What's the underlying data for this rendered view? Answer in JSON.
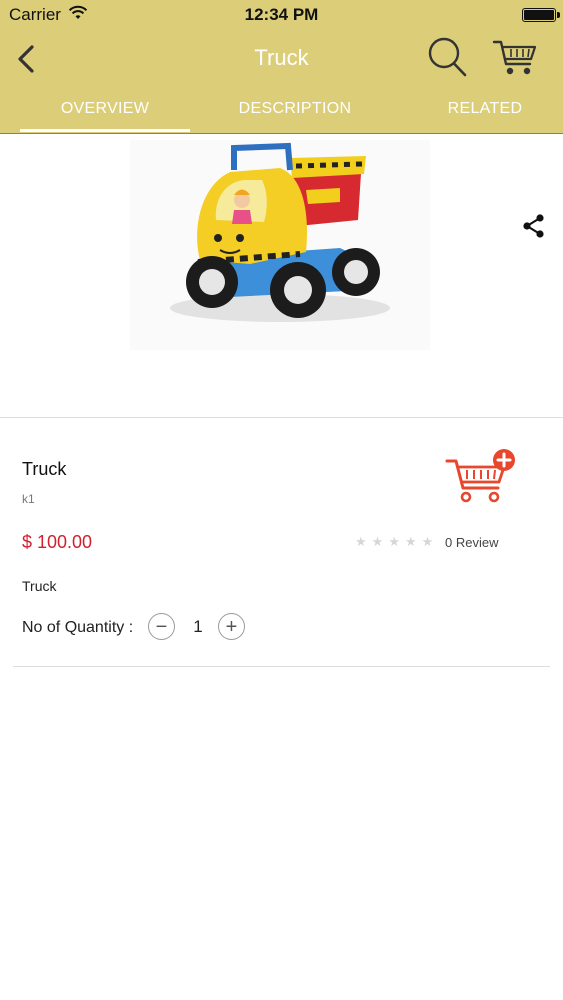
{
  "status_bar": {
    "carrier": "Carrier",
    "time": "12:34 PM",
    "battery_level": 1.0
  },
  "nav": {
    "title": "Truck"
  },
  "tabs": [
    {
      "label": "OVERVIEW",
      "active": true
    },
    {
      "label": "DESCRIPTION",
      "active": false
    },
    {
      "label": "RELATED",
      "active": false
    }
  ],
  "product": {
    "name": "Truck",
    "sku": "k1",
    "price": "$ 100.00",
    "rating": 0,
    "rating_max": 5,
    "review_text": "0 Review",
    "short_description": "Truck",
    "quantity_label": "No of Quantity :",
    "quantity": "1"
  },
  "colors": {
    "header_bg": "#dccd79",
    "price": "#d0202e",
    "cart_accent": "#e8472d",
    "star_empty": "#d6d6d6"
  },
  "icons": {
    "back": "chevron-left-icon",
    "search": "search-icon",
    "cart": "cart-icon",
    "share": "share-icon",
    "add_to_cart": "add-to-cart-icon"
  }
}
